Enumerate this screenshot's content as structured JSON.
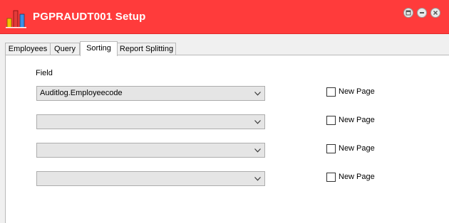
{
  "window": {
    "title": "PGPRAUDT001 Setup",
    "accent_color": "#ff3b3b",
    "app_icon": "bar-chart-icon",
    "controls": [
      "restore-icon",
      "minimize-icon",
      "close-icon"
    ]
  },
  "tabs": [
    {
      "label": "Employees",
      "active": false
    },
    {
      "label": "Query",
      "active": false
    },
    {
      "label": "Sorting",
      "active": true
    },
    {
      "label": "Report Splitting",
      "active": false
    }
  ],
  "sorting": {
    "field_label": "Field",
    "rows": [
      {
        "value": "Auditlog.Employeecode",
        "new_page_label": "New Page",
        "new_page_checked": false
      },
      {
        "value": "",
        "new_page_label": "New Page",
        "new_page_checked": false
      },
      {
        "value": "",
        "new_page_label": "New Page",
        "new_page_checked": false
      },
      {
        "value": "",
        "new_page_label": "New Page",
        "new_page_checked": false
      }
    ]
  }
}
